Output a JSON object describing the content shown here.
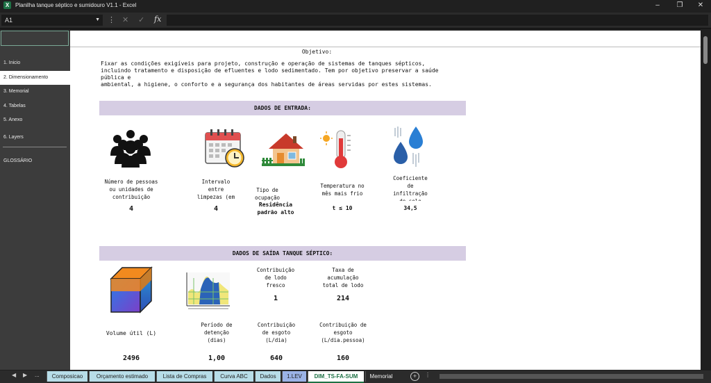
{
  "window": {
    "title": "Planilha tanque séptico e sumidouro V1.1 - Excel"
  },
  "formula_bar": {
    "name_box": "A1",
    "fx": "fx"
  },
  "sidebar": {
    "items": [
      {
        "label": "1. Inicio"
      },
      {
        "label": "2. Dimensionamento"
      },
      {
        "label": "3. Memorial"
      },
      {
        "label": "4. Tabelas"
      },
      {
        "label": "5. Anexo"
      },
      {
        "label": "6. Layers"
      },
      {
        "label": "GLOSSÁRIO"
      }
    ]
  },
  "sheet": {
    "objective_title": "Objetivo:",
    "objective_text": "Fixar as condições exigíveis para projeto, construção e operação de sistemas de tanques sépticos,\nincluindo tratamento e disposição de efluentes e lodo sedimentado. Tem por objetivo preservar a saúde\npública e\nambiental, a higiene, o conforto e a segurança dos habitantes de áreas servidas por estes sistemas.",
    "input_header": "DADOS DE ENTRADA:",
    "inputs": [
      {
        "label": "Número de pessoas\nou unidades de\ncontribuição",
        "value": "4"
      },
      {
        "label": "Intervalo\nentre\nlimpezas (em",
        "value": "4"
      },
      {
        "label": "Tipo de\nocupação",
        "value": "Residência\npadrão alto"
      },
      {
        "label": "Temperatura no\nmês mais frio",
        "value": "t ≤ 10"
      },
      {
        "label": "Coeficiente\nde\ninfiltração\nde solo",
        "value": "34,5"
      }
    ],
    "output_header": "DADOS DE SAÍDA TANQUE SÉPTICO:",
    "outputs": [
      {
        "label": "Contribuição\nde lodo\nfresco",
        "value": "1"
      },
      {
        "label": "Taxa de\nacumulação\ntotal de lodo",
        "value": "214"
      },
      {
        "label": "Volume útil (L)",
        "value": "2496"
      },
      {
        "label": "Período de\ndetenção\n(dias)",
        "value": "1,00"
      },
      {
        "label": "Contribuição\nde esgoto\n(L/dia)",
        "value": "640"
      },
      {
        "label": "Contribuição de\nesgoto\n(L/dia.pessoa)",
        "value": "160"
      }
    ]
  },
  "tabs": {
    "overflow": "...",
    "items": [
      "Composicao",
      "Orçamento estimado",
      "Lista de Compras",
      "Curva ABC",
      "Dados",
      "1.LEV",
      "DIM_TS-FA-SUM",
      "Memorial"
    ],
    "active": "DIM_TS-FA-SUM"
  },
  "icons": [
    "people-icon",
    "calendar-clock-icon",
    "house-icon",
    "thermometer-icon",
    "water-drops-icon",
    "cube-icon",
    "area-chart-icon"
  ],
  "colors": {
    "band": "#d6cde3",
    "tab": "#b7dde8",
    "excel_green": "#1e7145"
  }
}
